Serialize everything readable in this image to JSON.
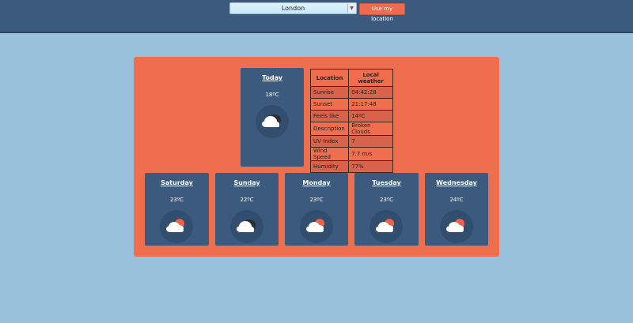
{
  "header": {
    "city_select_value": "London",
    "location_button_label": "Use my location"
  },
  "today": {
    "day": "Today",
    "temp": "18ºC",
    "icon": "broken-clouds-icon"
  },
  "details": {
    "headers": [
      "Location",
      "Local weather"
    ],
    "rows": [
      [
        "Sunrise",
        "04:42:28"
      ],
      [
        "Sunset",
        "21:17:48"
      ],
      [
        "Feels like",
        "14ºC"
      ],
      [
        "Description",
        "Broken Clouds"
      ],
      [
        "UV Index",
        "7"
      ],
      [
        "Wind Speed",
        "7.7 m/s"
      ],
      [
        "Humidity",
        "77%"
      ]
    ]
  },
  "forecast": [
    {
      "day": "Saturday",
      "temp": "23ºC",
      "icon": "sun-cloud-icon"
    },
    {
      "day": "Sunday",
      "temp": "22ºC",
      "icon": "broken-clouds-icon"
    },
    {
      "day": "Monday",
      "temp": "23ºC",
      "icon": "sun-cloud-icon"
    },
    {
      "day": "Tuesday",
      "temp": "23ºC",
      "icon": "sun-cloud-icon"
    },
    {
      "day": "Wednesday",
      "temp": "24ºC",
      "icon": "sun-cloud-icon"
    }
  ],
  "colors": {
    "background": "#9bc2dc",
    "topbar": "#3c5a7e",
    "panel": "#ef6e4e",
    "card": "#3c5a7e",
    "sun": "#f0604a"
  }
}
